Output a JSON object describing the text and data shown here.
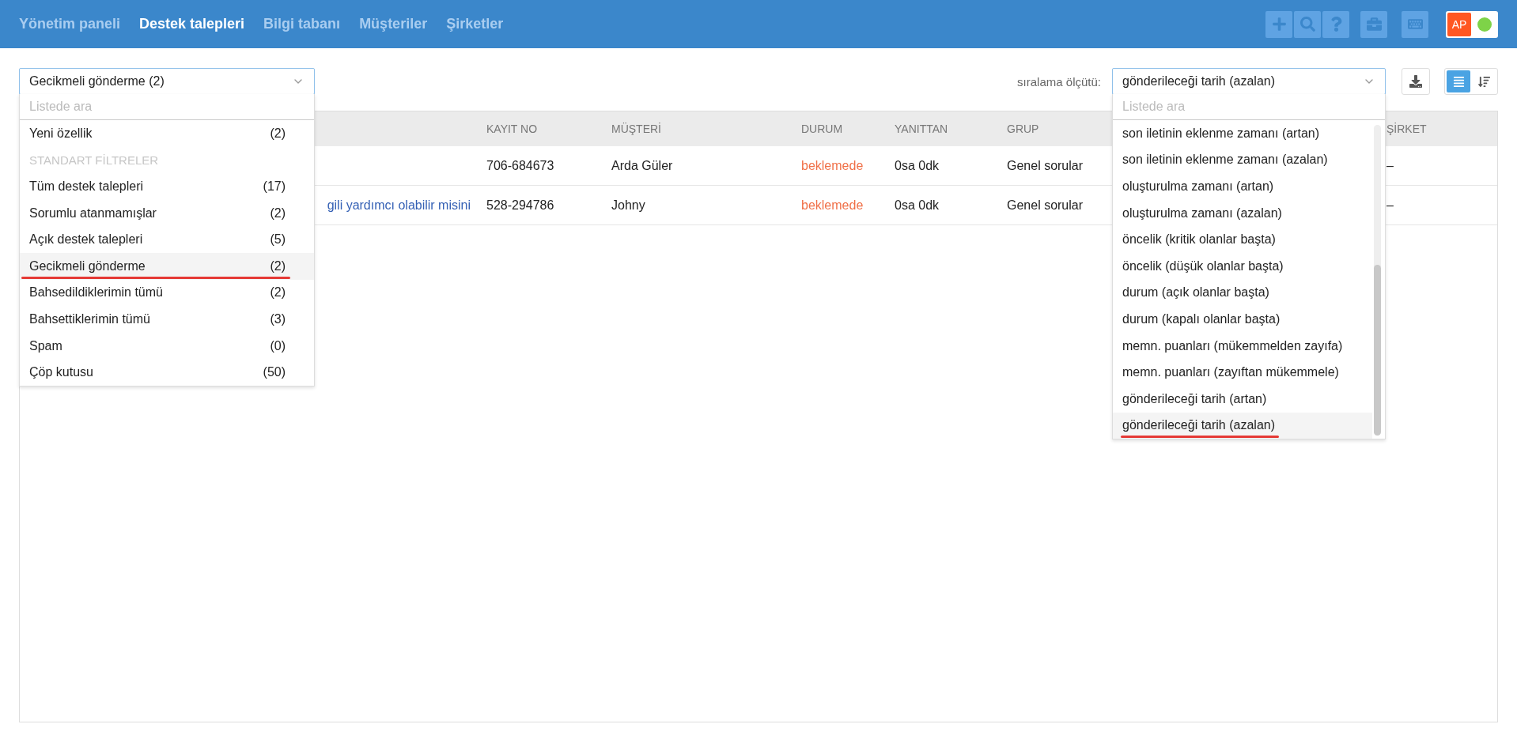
{
  "nav": {
    "items": [
      {
        "label": "Yönetim paneli",
        "selected": false
      },
      {
        "label": "Destek talepleri",
        "selected": true
      },
      {
        "label": "Bilgi tabanı",
        "selected": false
      },
      {
        "label": "Müşteriler",
        "selected": false
      },
      {
        "label": "Şirketler",
        "selected": false
      }
    ]
  },
  "user": {
    "initials": "AP",
    "online": true
  },
  "filter": {
    "value": "Gecikmeli gönderme (2)",
    "placeholder": "Listede ara",
    "options": [
      {
        "kind": "item",
        "label": "Yeni özellik",
        "count": "(2)",
        "selected": false
      },
      {
        "kind": "header",
        "label": "STANDART FİLTRELER"
      },
      {
        "kind": "item",
        "label": "Tüm destek talepleri",
        "count": "(17)",
        "selected": false
      },
      {
        "kind": "item",
        "label": "Sorumlu atanmamışlar",
        "count": "(2)",
        "selected": false
      },
      {
        "kind": "item",
        "label": "Açık destek talepleri",
        "count": "(5)",
        "selected": false
      },
      {
        "kind": "item",
        "label": "Gecikmeli gönderme",
        "count": "(2)",
        "selected": true
      },
      {
        "kind": "item",
        "label": "Bahsedildiklerimin tümü",
        "count": "(2)",
        "selected": false
      },
      {
        "kind": "item",
        "label": "Bahsettiklerimin tümü",
        "count": "(3)",
        "selected": false
      },
      {
        "kind": "item",
        "label": "Spam",
        "count": "(0)",
        "selected": false
      },
      {
        "kind": "item",
        "label": "Çöp kutusu",
        "count": "(50)",
        "selected": false
      }
    ]
  },
  "sort": {
    "label": "sıralama ölçütü:",
    "value": "gönderileceği tarih (azalan)",
    "placeholder": "Listede ara",
    "options": [
      {
        "label": "son iletinin eklenme zamanı (artan)",
        "selected": false
      },
      {
        "label": "son iletinin eklenme zamanı (azalan)",
        "selected": false
      },
      {
        "label": "oluşturulma zamanı (artan)",
        "selected": false
      },
      {
        "label": "oluşturulma zamanı (azalan)",
        "selected": false
      },
      {
        "label": "öncelik (kritik olanlar başta)",
        "selected": false
      },
      {
        "label": "öncelik (düşük olanlar başta)",
        "selected": false
      },
      {
        "label": "durum (açık olanlar başta)",
        "selected": false
      },
      {
        "label": "durum (kapalı olanlar başta)",
        "selected": false
      },
      {
        "label": "memn. puanları (mükemmelden zayıfa)",
        "selected": false
      },
      {
        "label": "memn. puanları (zayıftan mükemmele)",
        "selected": false
      },
      {
        "label": "gönderileceği tarih (artan)",
        "selected": false
      },
      {
        "label": "gönderileceği tarih (azalan)",
        "selected": true
      }
    ]
  },
  "views": [
    {
      "kind": "list",
      "selected": true
    },
    {
      "kind": "compact",
      "selected": false
    }
  ],
  "table": {
    "columns": [
      {
        "label": "KAYIT NO",
        "kind": "text"
      },
      {
        "label": "MÜŞTERİ",
        "kind": "text"
      },
      {
        "label": "DURUM",
        "kind": "status"
      },
      {
        "label": "YANITTAN",
        "kind": "text"
      },
      {
        "label": "GRUP",
        "kind": "group"
      },
      {
        "label": "ŞİRKET",
        "kind": "text"
      }
    ],
    "rows": [
      {
        "cells": [
          "706-684673",
          "Arda Güler",
          "beklemede",
          "0sa 0dk",
          "Genel sorular",
          "–"
        ]
      },
      {
        "title": "gili yardımcı olabilir misini",
        "cells": [
          "528-294786",
          "Johny",
          "beklemede",
          "0sa 0dk",
          "Genel sorular",
          "–"
        ]
      }
    ]
  }
}
